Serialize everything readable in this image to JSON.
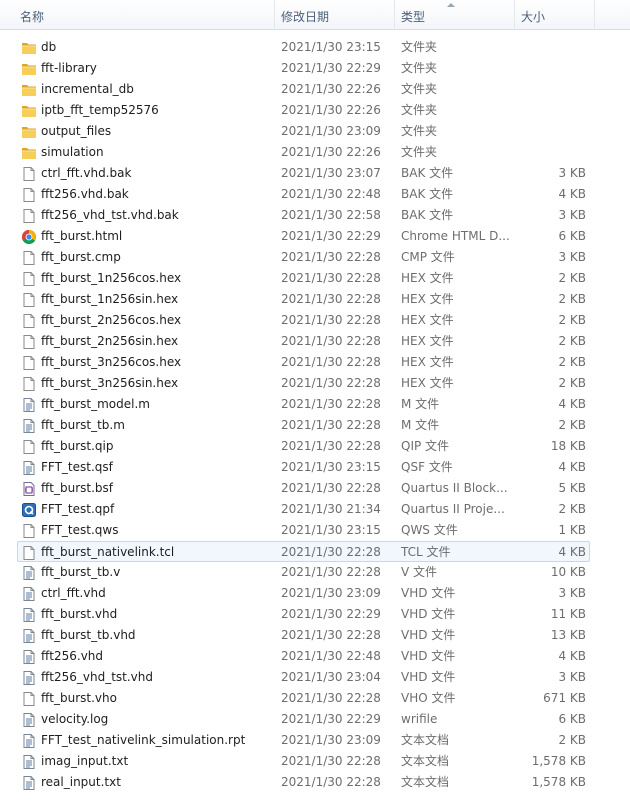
{
  "columns": {
    "name": "名称",
    "date": "修改日期",
    "type": "类型",
    "size": "大小"
  },
  "files": [
    {
      "name": "db",
      "date": "2021/1/30 23:15",
      "type": "文件夹",
      "size": "",
      "icon": "folder-icon"
    },
    {
      "name": "fft-library",
      "date": "2021/1/30 22:29",
      "type": "文件夹",
      "size": "",
      "icon": "folder-icon"
    },
    {
      "name": "incremental_db",
      "date": "2021/1/30 22:26",
      "type": "文件夹",
      "size": "",
      "icon": "folder-icon"
    },
    {
      "name": "iptb_fft_temp52576",
      "date": "2021/1/30 22:26",
      "type": "文件夹",
      "size": "",
      "icon": "folder-icon"
    },
    {
      "name": "output_files",
      "date": "2021/1/30 23:09",
      "type": "文件夹",
      "size": "",
      "icon": "folder-icon"
    },
    {
      "name": "simulation",
      "date": "2021/1/30 22:26",
      "type": "文件夹",
      "size": "",
      "icon": "folder-icon"
    },
    {
      "name": "ctrl_fft.vhd.bak",
      "date": "2021/1/30 23:07",
      "type": "BAK 文件",
      "size": "3 KB",
      "icon": "file-icon"
    },
    {
      "name": "fft256.vhd.bak",
      "date": "2021/1/30 22:48",
      "type": "BAK 文件",
      "size": "4 KB",
      "icon": "file-icon"
    },
    {
      "name": "fft256_vhd_tst.vhd.bak",
      "date": "2021/1/30 22:58",
      "type": "BAK 文件",
      "size": "3 KB",
      "icon": "file-icon"
    },
    {
      "name": "fft_burst.html",
      "date": "2021/1/30 22:29",
      "type": "Chrome HTML D...",
      "size": "6 KB",
      "icon": "chrome-icon"
    },
    {
      "name": "fft_burst.cmp",
      "date": "2021/1/30 22:28",
      "type": "CMP 文件",
      "size": "3 KB",
      "icon": "file-icon"
    },
    {
      "name": "fft_burst_1n256cos.hex",
      "date": "2021/1/30 22:28",
      "type": "HEX 文件",
      "size": "2 KB",
      "icon": "file-icon"
    },
    {
      "name": "fft_burst_1n256sin.hex",
      "date": "2021/1/30 22:28",
      "type": "HEX 文件",
      "size": "2 KB",
      "icon": "file-icon"
    },
    {
      "name": "fft_burst_2n256cos.hex",
      "date": "2021/1/30 22:28",
      "type": "HEX 文件",
      "size": "2 KB",
      "icon": "file-icon"
    },
    {
      "name": "fft_burst_2n256sin.hex",
      "date": "2021/1/30 22:28",
      "type": "HEX 文件",
      "size": "2 KB",
      "icon": "file-icon"
    },
    {
      "name": "fft_burst_3n256cos.hex",
      "date": "2021/1/30 22:28",
      "type": "HEX 文件",
      "size": "2 KB",
      "icon": "file-icon"
    },
    {
      "name": "fft_burst_3n256sin.hex",
      "date": "2021/1/30 22:28",
      "type": "HEX 文件",
      "size": "2 KB",
      "icon": "file-icon"
    },
    {
      "name": "fft_burst_model.m",
      "date": "2021/1/30 22:28",
      "type": "M 文件",
      "size": "4 KB",
      "icon": "doc-file-icon"
    },
    {
      "name": "fft_burst_tb.m",
      "date": "2021/1/30 22:28",
      "type": "M 文件",
      "size": "2 KB",
      "icon": "doc-file-icon"
    },
    {
      "name": "fft_burst.qip",
      "date": "2021/1/30 22:28",
      "type": "QIP 文件",
      "size": "18 KB",
      "icon": "file-icon"
    },
    {
      "name": "FFT_test.qsf",
      "date": "2021/1/30 23:15",
      "type": "QSF 文件",
      "size": "4 KB",
      "icon": "doc-file-icon"
    },
    {
      "name": "fft_burst.bsf",
      "date": "2021/1/30 22:28",
      "type": "Quartus II Block...",
      "size": "5 KB",
      "icon": "quartus-block-icon"
    },
    {
      "name": "FFT_test.qpf",
      "date": "2021/1/30 21:34",
      "type": "Quartus II Proje...",
      "size": "2 KB",
      "icon": "quartus-project-icon"
    },
    {
      "name": "FFT_test.qws",
      "date": "2021/1/30 23:15",
      "type": "QWS 文件",
      "size": "1 KB",
      "icon": "file-icon"
    },
    {
      "name": "fft_burst_nativelink.tcl",
      "date": "2021/1/30 22:28",
      "type": "TCL 文件",
      "size": "4 KB",
      "icon": "file-icon",
      "highlight": true
    },
    {
      "name": "fft_burst_tb.v",
      "date": "2021/1/30 22:28",
      "type": "V 文件",
      "size": "10 KB",
      "icon": "doc-file-icon"
    },
    {
      "name": "ctrl_fft.vhd",
      "date": "2021/1/30 23:09",
      "type": "VHD 文件",
      "size": "3 KB",
      "icon": "doc-file-icon"
    },
    {
      "name": "fft_burst.vhd",
      "date": "2021/1/30 22:29",
      "type": "VHD 文件",
      "size": "11 KB",
      "icon": "doc-file-icon"
    },
    {
      "name": "fft_burst_tb.vhd",
      "date": "2021/1/30 22:28",
      "type": "VHD 文件",
      "size": "13 KB",
      "icon": "doc-file-icon"
    },
    {
      "name": "fft256.vhd",
      "date": "2021/1/30 22:48",
      "type": "VHD 文件",
      "size": "4 KB",
      "icon": "doc-file-icon"
    },
    {
      "name": "fft256_vhd_tst.vhd",
      "date": "2021/1/30 23:04",
      "type": "VHD 文件",
      "size": "3 KB",
      "icon": "doc-file-icon"
    },
    {
      "name": "fft_burst.vho",
      "date": "2021/1/30 22:28",
      "type": "VHO 文件",
      "size": "671 KB",
      "icon": "file-icon"
    },
    {
      "name": "velocity.log",
      "date": "2021/1/30 22:29",
      "type": "wrifile",
      "size": "6 KB",
      "icon": "doc-file-icon"
    },
    {
      "name": "FFT_test_nativelink_simulation.rpt",
      "date": "2021/1/30 23:09",
      "type": "文本文档",
      "size": "2 KB",
      "icon": "doc-file-icon"
    },
    {
      "name": "imag_input.txt",
      "date": "2021/1/30 22:28",
      "type": "文本文档",
      "size": "1,578 KB",
      "icon": "doc-file-icon"
    },
    {
      "name": "real_input.txt",
      "date": "2021/1/30 22:28",
      "type": "文本文档",
      "size": "1,578 KB",
      "icon": "doc-file-icon"
    }
  ]
}
